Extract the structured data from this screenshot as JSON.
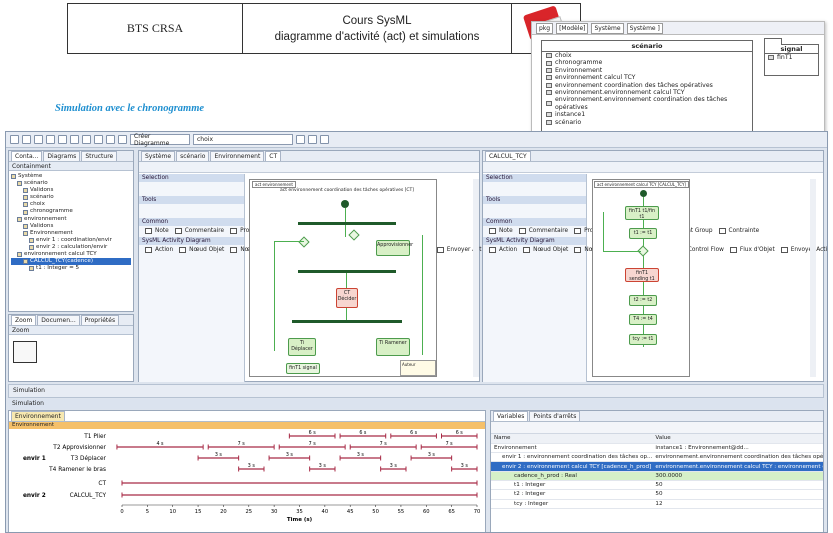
{
  "header": {
    "left_cell": "BTS CRSA",
    "title_line1": "Cours SysML",
    "title_line2": "diagramme d'activité (act) et simulations"
  },
  "package_diagram": {
    "tabs": [
      "pkg",
      "[Modèle]",
      "Système",
      "Système ]"
    ],
    "scenario": {
      "title": "scénario",
      "items": [
        "choix",
        "chronogramme",
        "Environnement",
        "environnement calcul TCY",
        "environnement coordination des tâches opératives",
        "environnement.environnement calcul TCY",
        "environnement.environnement coordination des tâches opératives",
        "instance1",
        "scénario"
      ]
    },
    "signal": {
      "title": "signal",
      "items": [
        "finT1"
      ]
    }
  },
  "caption": "Simulation avec le chronogramme",
  "app": {
    "toolbar": {
      "create_diagram": "Créer Diagramme",
      "choix": "choix"
    },
    "containment": {
      "tabs": [
        "Conta...",
        "Diagrams",
        "Structure"
      ],
      "title": "Containment",
      "tree": [
        "Système",
        "scénario",
        "Validons",
        "scénario",
        "choix",
        "chronogramme",
        "environnement",
        "Validons",
        "Environnement",
        "envir 1 : coordination/envir",
        "envir 2 : calculation/envir",
        "environnement calcul TCY",
        "CALCUL_TCY(cadence)",
        "t1 : Integer = 5"
      ]
    },
    "zoom": {
      "tabs": [
        "Zoom",
        "Documen...",
        "Propriétés"
      ],
      "title": "Zoom"
    },
    "diagram_tabs_left": [
      "Système",
      "scénario",
      "Environnement",
      "CT"
    ],
    "diagram_tabs_right": [
      "CALCUL_TCY"
    ],
    "palette": {
      "selection": "Selection",
      "tools": "Tools",
      "common": "Common",
      "common_items": [
        "Note",
        "Commentaire",
        "Problem",
        "Référence",
        "Element Group",
        "Contrainte"
      ],
      "sysml_header": "SysML Activity Diagram",
      "sysml_items": [
        "Action",
        "Nœud Objet",
        "Nœud de Paramètre d'Activité",
        "Control Flow",
        "Flux d'Objet",
        "Envoyer Action de Signal"
      ]
    },
    "ct_diagram": {
      "title": "act environnement coordination des tâches opératives [CT]",
      "action1": "Approvisionner",
      "action2": "CT Décider",
      "action3": "Ti Déplacer",
      "action4": "Ti Ramener",
      "signal": "finT1 signal",
      "note": "Auteur"
    },
    "calc_diagram": {
      "title": "act environnement calcul TCY [CALCUL_TCY]",
      "nodes": [
        "finT1 t1/fin t1",
        "t1 := t1",
        "finT1 sending t1",
        "t2 := t2",
        "T4 := t4",
        "tcy := t1"
      ]
    },
    "simulation": {
      "panel_title": "Simulation",
      "sub_title": "Simulation",
      "tab": "Environnement",
      "area_title": "Environnement",
      "row_labels": [
        "T1 Plier",
        "T2 Approvisionner",
        "T3 Déplacer",
        "T4 Ramener le bras",
        "CT",
        "CALCUL_TCY"
      ],
      "group1": "envir 1",
      "group2": "envir 2",
      "x_label": "Time (s)",
      "x_ticks": [
        "0",
        "5",
        "10",
        "15",
        "20",
        "25",
        "30",
        "35",
        "40",
        "45",
        "50",
        "55",
        "60",
        "65",
        "70"
      ]
    },
    "variables": {
      "tabs": [
        "Variables",
        "Points d'arrêts"
      ],
      "headers": [
        "Name",
        "Value"
      ],
      "rows": [
        [
          "Environnement",
          "instance1 : Environnement@dd..."
        ],
        [
          "envir 1 : environnement coordination des tâches op...",
          "environnement.environnement coordination des tâches opérat..."
        ],
        [
          "envir 2 : environnement calcul TCY [cadence_h_prod]",
          "environnement.environnement calcul TCY : environnement cal..."
        ],
        [
          "cadence_h_prod : Real",
          "300.0000"
        ],
        [
          "t1 : Integer",
          "50"
        ],
        [
          "t2 : Integer",
          "50"
        ],
        [
          "tcy : Integer",
          "12"
        ]
      ]
    }
  },
  "chart_data": {
    "type": "table",
    "title": "Environnement chronogramme",
    "xlabel": "Time (s)",
    "xlim": [
      0,
      70
    ],
    "series": [
      {
        "name": "T1 Plier",
        "segments": [
          [
            33,
            42
          ],
          [
            43,
            52
          ],
          [
            53,
            62
          ],
          [
            63,
            72
          ]
        ],
        "labels": [
          "6 s",
          "6 s",
          "6 s",
          "6 s"
        ]
      },
      {
        "name": "T2 Approvisionner",
        "segments": [
          [
            -1,
            16
          ],
          [
            17,
            30
          ],
          [
            31,
            44
          ],
          [
            45,
            58
          ],
          [
            59,
            72
          ]
        ],
        "labels": [
          "4 s",
          "7 s",
          "7 s",
          "7 s",
          "7 s"
        ]
      },
      {
        "name": "T3 Déplacer",
        "segments": [
          [
            15,
            23
          ],
          [
            29,
            37
          ],
          [
            43,
            51
          ],
          [
            57,
            65
          ]
        ],
        "labels": [
          "3 s",
          "3 s",
          "3 s",
          "3 s"
        ]
      },
      {
        "name": "T4 Ramener le bras",
        "segments": [
          [
            23,
            28
          ],
          [
            37,
            42
          ],
          [
            51,
            56
          ],
          [
            65,
            70
          ]
        ],
        "labels": [
          "3 s",
          "3 s",
          "3 s",
          "3 s"
        ]
      },
      {
        "name": "CT",
        "segments": [
          [
            0,
            70
          ]
        ],
        "labels": [
          ""
        ]
      },
      {
        "name": "CALCUL_TCY",
        "segments": [
          [
            0,
            70
          ]
        ],
        "labels": [
          ""
        ]
      }
    ]
  }
}
